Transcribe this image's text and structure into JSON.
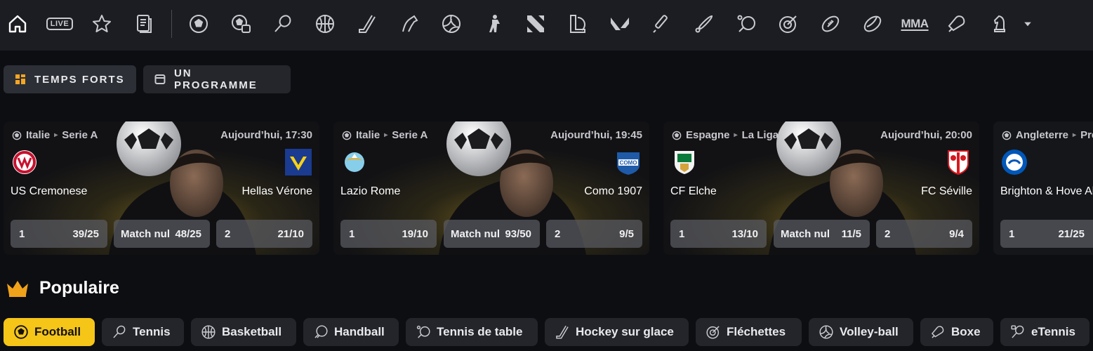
{
  "topnav": {
    "icons": [
      "home-icon",
      "live-icon",
      "favorites-icon",
      "betslip-icon",
      "football-icon",
      "football-virtual-icon",
      "tennis-icon",
      "basketball-icon",
      "hockey-icon",
      "horse-racing-icon",
      "volleyball-icon",
      "counter-strike-icon",
      "dota2-icon",
      "league-of-legends-icon",
      "valorant-icon",
      "cricket-icon",
      "baseball-icon",
      "table-tennis-icon",
      "darts-icon",
      "american-football-icon",
      "rugby-icon",
      "mma-icon",
      "boxing-icon",
      "chess-icon",
      "more-dropdown-icon"
    ],
    "live_label": "LIVE",
    "mma_label": "MMA"
  },
  "view_tabs": [
    {
      "label": "TEMPS FORTS",
      "active": true
    },
    {
      "label": "UN PROGRAMME",
      "active": false
    }
  ],
  "highlights": [
    {
      "country": "Italie",
      "league": "Serie A",
      "time": "Aujourd’hui, 17:30",
      "home": "US Cremonese",
      "away": "Hellas Vérone",
      "odds": [
        {
          "label": "1",
          "value": "39/25"
        },
        {
          "label": "Match nul",
          "value": "48/25"
        },
        {
          "label": "2",
          "value": "21/10"
        }
      ]
    },
    {
      "country": "Italie",
      "league": "Serie A",
      "time": "Aujourd’hui, 19:45",
      "home": "Lazio Rome",
      "away": "Como 1907",
      "odds": [
        {
          "label": "1",
          "value": "19/10"
        },
        {
          "label": "Match nul",
          "value": "93/50"
        },
        {
          "label": "2",
          "value": "9/5"
        }
      ]
    },
    {
      "country": "Espagne",
      "league": "La Liga",
      "time": "Aujourd’hui, 20:00",
      "home": "CF Elche",
      "away": "FC Séville",
      "odds": [
        {
          "label": "1",
          "value": "13/10"
        },
        {
          "label": "Match nul",
          "value": "11/5"
        },
        {
          "label": "2",
          "value": "9/4"
        }
      ]
    },
    {
      "country": "Angleterre",
      "league": "Premier League",
      "time": "",
      "home": "Brighton & Hove Albion",
      "away": "",
      "odds": [
        {
          "label": "1",
          "value": "21/25"
        }
      ]
    }
  ],
  "popular": {
    "title": "Populaire",
    "chips": [
      {
        "label": "Football",
        "icon": "football-icon",
        "active": true
      },
      {
        "label": "Tennis",
        "icon": "tennis-icon",
        "active": false
      },
      {
        "label": "Basketball",
        "icon": "basketball-icon",
        "active": false
      },
      {
        "label": "Handball",
        "icon": "handball-icon",
        "active": false
      },
      {
        "label": "Tennis de table",
        "icon": "table-tennis-icon",
        "active": false
      },
      {
        "label": "Hockey sur glace",
        "icon": "ice-hockey-icon",
        "active": false
      },
      {
        "label": "Fléchettes",
        "icon": "darts-icon",
        "active": false
      },
      {
        "label": "Volley-ball",
        "icon": "volleyball-icon",
        "active": false
      },
      {
        "label": "Boxe",
        "icon": "boxing-icon",
        "active": false
      },
      {
        "label": "eTennis",
        "icon": "etennis-icon",
        "active": false
      }
    ]
  },
  "colors": {
    "accent": "#f5c518",
    "crown": "#f0a21a",
    "topbar": "#1c1d22",
    "background": "#0d0e12"
  }
}
